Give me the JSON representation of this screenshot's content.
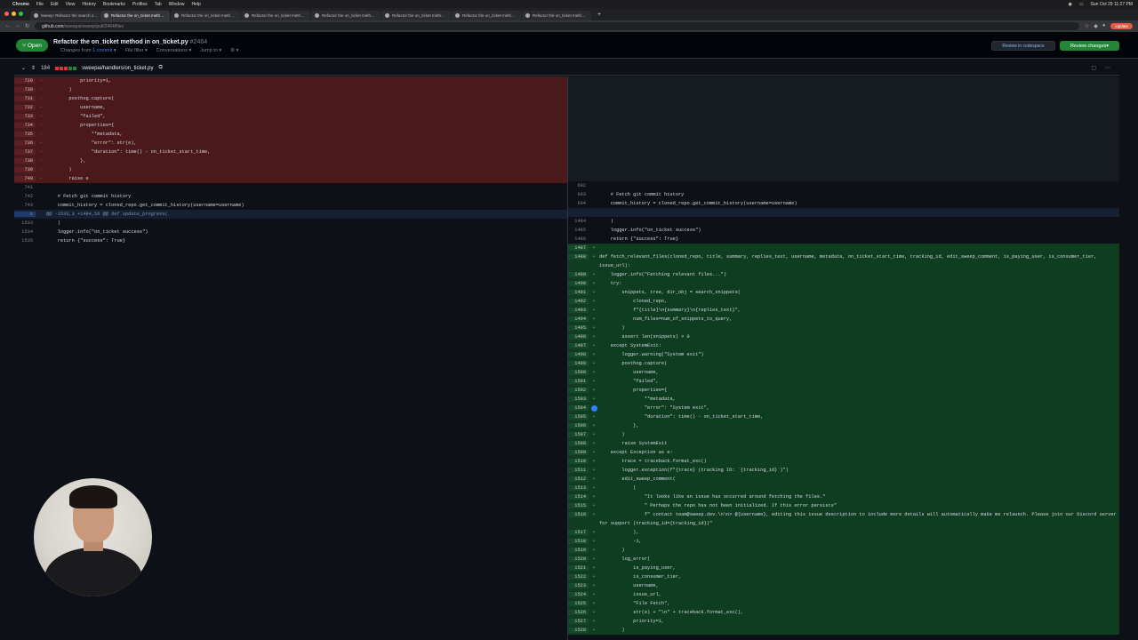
{
  "mac": {
    "app": "Chrome",
    "menus": [
      "File",
      "Edit",
      "View",
      "History",
      "Bookmarks",
      "Profiles",
      "Tab",
      "Window",
      "Help"
    ],
    "datetime": "Sun Oct 29  11:27 PM"
  },
  "tabs": [
    {
      "label": "Sweep: Refactor the search o…",
      "active": false
    },
    {
      "label": "Refactor the on_ticket meth…",
      "active": true
    },
    {
      "label": "Refactor the on_ticket meth…",
      "active": false
    },
    {
      "label": "Refactor the on_ticket meth…",
      "active": false
    },
    {
      "label": "Refactor the on_ticket meth…",
      "active": false
    },
    {
      "label": "Refactor the on_ticket meth…",
      "active": false
    },
    {
      "label": "Refactor the on_ticket meth…",
      "active": false
    },
    {
      "label": "Refactor the on_ticket meth…",
      "active": false
    }
  ],
  "address": {
    "url": "github.com",
    "url_rest": "/sweepai/sweep/pull/2464/files",
    "update": "Update"
  },
  "pr": {
    "status": "Open",
    "title": "Refactor the on_ticket method in on_ticket.py",
    "number": "#2464",
    "changes_from": "Changes from",
    "commit_link": "1 commit",
    "file_filter": "File filter",
    "conversations": "Conversations",
    "jump_to": "Jump to",
    "review_codespace": "Review in codespace",
    "review_changes": "Review changes"
  },
  "file": {
    "count": "184",
    "path": "sweepai/handlers/on_ticket.py"
  },
  "left_rows": [
    {
      "t": "del",
      "ln": "729",
      "mk": "-",
      "code": "            priority=1,"
    },
    {
      "t": "del",
      "ln": "730",
      "mk": "-",
      "code": "        )"
    },
    {
      "t": "del",
      "ln": "731",
      "mk": "-",
      "code": "        posthog.capture("
    },
    {
      "t": "del",
      "ln": "732",
      "mk": "-",
      "code": "            username,"
    },
    {
      "t": "del",
      "ln": "733",
      "mk": "-",
      "code": "            \"failed\","
    },
    {
      "t": "del",
      "ln": "734",
      "mk": "-",
      "code": "            properties={"
    },
    {
      "t": "del",
      "ln": "735",
      "mk": "-",
      "code": "                **metadata,"
    },
    {
      "t": "del",
      "ln": "736",
      "mk": "-",
      "code": "                \"error\": str(e),"
    },
    {
      "t": "del",
      "ln": "737",
      "mk": "-",
      "code": "                \"duration\": time() - on_ticket_start_time,"
    },
    {
      "t": "del",
      "ln": "738",
      "mk": "-",
      "code": "            },"
    },
    {
      "t": "del",
      "ln": "739",
      "mk": "-",
      "code": "        )"
    },
    {
      "t": "del",
      "ln": "740",
      "mk": "-",
      "code": "        raise e"
    },
    {
      "t": "ctx",
      "ln": "741",
      "mk": "",
      "code": ""
    },
    {
      "t": "ctx",
      "ln": "742",
      "mk": "",
      "code": "    # Fetch git commit history"
    },
    {
      "t": "ctx",
      "ln": "743",
      "mk": "",
      "code": "    commit_history = cloned_repo.get_commit_history(username=username)"
    },
    {
      "t": "hunk",
      "ln": "⇕",
      "mk": "",
      "code": "@@ -1533,3 +1484,56 @@ def update_progress("
    },
    {
      "t": "ctx",
      "ln": "1533",
      "mk": "",
      "code": "    )"
    },
    {
      "t": "ctx",
      "ln": "1534",
      "mk": "",
      "code": "    logger.info(\"on_ticket success\")"
    },
    {
      "t": "ctx",
      "ln": "1535",
      "mk": "",
      "code": "    return {\"success\": True}"
    }
  ],
  "right_rows": [
    {
      "t": "ctx",
      "ln": "692",
      "mk": "",
      "code": ""
    },
    {
      "t": "ctx",
      "ln": "693",
      "mk": "",
      "code": "    # Fetch git commit history"
    },
    {
      "t": "ctx",
      "ln": "694",
      "mk": "",
      "code": "    commit_history = cloned_repo.get_commit_history(username=username)"
    },
    {
      "t": "hunk",
      "ln": "",
      "mk": "",
      "code": ""
    },
    {
      "t": "ctx",
      "ln": "1484",
      "mk": "",
      "code": "    )"
    },
    {
      "t": "ctx",
      "ln": "1485",
      "mk": "",
      "code": "    logger.info(\"on_ticket success\")"
    },
    {
      "t": "ctx",
      "ln": "1486",
      "mk": "",
      "code": "    return {\"success\": True}"
    },
    {
      "t": "add",
      "ln": "1487",
      "mk": "+",
      "code": ""
    },
    {
      "t": "add tall",
      "ln": "1488",
      "mk": "+",
      "code": "def fetch_relevant_files(cloned_repo, title, summary, replies_text, username, metadata, on_ticket_start_time, tracking_id, edit_sweep_comment, is_paying_user, is_consumer_tier, issue_url):"
    },
    {
      "t": "add",
      "ln": "1489",
      "mk": "+",
      "code": "    logger.info(\"Fetching relevant files...\")"
    },
    {
      "t": "add",
      "ln": "1490",
      "mk": "+",
      "code": "    try:"
    },
    {
      "t": "add",
      "ln": "1491",
      "mk": "+",
      "code": "        snippets, tree, dir_obj = search_snippets("
    },
    {
      "t": "add",
      "ln": "1492",
      "mk": "+",
      "code": "            cloned_repo,"
    },
    {
      "t": "add",
      "ln": "1493",
      "mk": "+",
      "code": "            f\"{title}\\n{summary}\\n{replies_text}\","
    },
    {
      "t": "add",
      "ln": "1494",
      "mk": "+",
      "code": "            num_files=num_of_snippets_to_query,"
    },
    {
      "t": "add",
      "ln": "1495",
      "mk": "+",
      "code": "        )"
    },
    {
      "t": "add",
      "ln": "1496",
      "mk": "+",
      "code": "        assert len(snippets) > 0"
    },
    {
      "t": "add",
      "ln": "1497",
      "mk": "+",
      "code": "    except SystemExit:"
    },
    {
      "t": "add",
      "ln": "1498",
      "mk": "+",
      "code": "        logger.warning(\"System exit\")"
    },
    {
      "t": "add",
      "ln": "1499",
      "mk": "+",
      "code": "        posthog.capture("
    },
    {
      "t": "add",
      "ln": "1500",
      "mk": "+",
      "code": "            username,"
    },
    {
      "t": "add",
      "ln": "1501",
      "mk": "+",
      "code": "            \"failed\","
    },
    {
      "t": "add",
      "ln": "1502",
      "mk": "+",
      "code": "            properties={"
    },
    {
      "t": "add",
      "ln": "1503",
      "mk": "+",
      "code": "                **metadata,"
    },
    {
      "t": "add",
      "ln": "1504",
      "mk": "+",
      "code": "                \"error\": \"System exit\","
    },
    {
      "t": "add",
      "ln": "1505",
      "mk": "+",
      "code": "                \"duration\": time() - on_ticket_start_time,"
    },
    {
      "t": "add",
      "ln": "1506",
      "mk": "+",
      "code": "            },"
    },
    {
      "t": "add",
      "ln": "1507",
      "mk": "+",
      "code": "        )"
    },
    {
      "t": "add",
      "ln": "1508",
      "mk": "+",
      "code": "        raise SystemExit"
    },
    {
      "t": "add",
      "ln": "1509",
      "mk": "+",
      "code": "    except Exception as e:"
    },
    {
      "t": "add",
      "ln": "1510",
      "mk": "+",
      "code": "        trace = traceback.format_exc()"
    },
    {
      "t": "add",
      "ln": "1511",
      "mk": "+",
      "code": "        logger.exception(f\"{trace} (tracking ID: `{tracking_id}`)\")"
    },
    {
      "t": "add",
      "ln": "1512",
      "mk": "+",
      "code": "        edit_sweep_comment("
    },
    {
      "t": "add",
      "ln": "1513",
      "mk": "+",
      "code": "            ("
    },
    {
      "t": "add",
      "ln": "1514",
      "mk": "+",
      "code": "                \"It looks like an issue has occurred around fetching the files.\""
    },
    {
      "t": "add",
      "ln": "1515",
      "mk": "+",
      "code": "                \" Perhaps the repo has not been initialized. If this error persists\""
    },
    {
      "t": "add tall",
      "ln": "1516",
      "mk": "+",
      "code": "                f\" contact team@sweep.dev.\\n\\n> @{username}, editing this issue description to include more details will automatically make me relaunch. Please join our Discord server for support (tracking_id={tracking_id})\""
    },
    {
      "t": "add",
      "ln": "1517",
      "mk": "+",
      "code": "            ),"
    },
    {
      "t": "add",
      "ln": "1518",
      "mk": "+",
      "code": "            -1,"
    },
    {
      "t": "add",
      "ln": "1519",
      "mk": "+",
      "code": "        )"
    },
    {
      "t": "add",
      "ln": "1520",
      "mk": "+",
      "code": "        log_error("
    },
    {
      "t": "add",
      "ln": "1521",
      "mk": "+",
      "code": "            is_paying_user,"
    },
    {
      "t": "add",
      "ln": "1522",
      "mk": "+",
      "code": "            is_consumer_tier,"
    },
    {
      "t": "add",
      "ln": "1523",
      "mk": "+",
      "code": "            username,"
    },
    {
      "t": "add",
      "ln": "1524",
      "mk": "+",
      "code": "            issue_url,"
    },
    {
      "t": "add",
      "ln": "1525",
      "mk": "+",
      "code": "            \"File Fetch\","
    },
    {
      "t": "add",
      "ln": "1526",
      "mk": "+",
      "code": "            str(e) + \"\\n\" + traceback.format_exc(),"
    },
    {
      "t": "add",
      "ln": "1527",
      "mk": "+",
      "code": "            priority=1,"
    },
    {
      "t": "add",
      "ln": "1528",
      "mk": "+",
      "code": "        )"
    }
  ]
}
